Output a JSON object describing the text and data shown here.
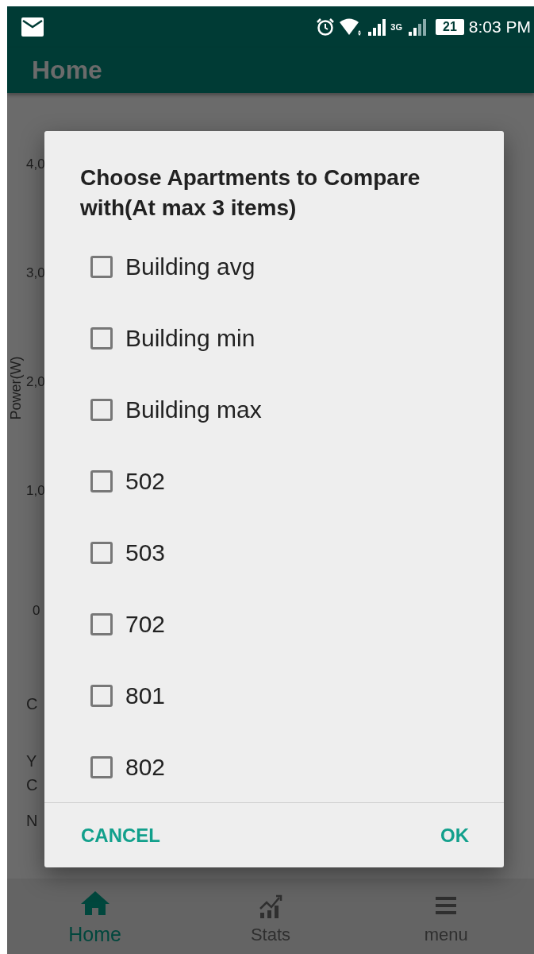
{
  "status_bar": {
    "time": "8:03 PM",
    "network": "3G",
    "battery": "21"
  },
  "app_bar": {
    "title": "Home"
  },
  "background": {
    "y_ticks": [
      "4,0",
      "3,0",
      "2,0",
      "1,0",
      "0"
    ],
    "y_label": "Power(W)",
    "lines": [
      "C",
      "Y",
      "C",
      "N"
    ]
  },
  "dialog": {
    "title": "Choose Apartments to Compare with(At max 3 items)",
    "items": [
      {
        "label": "Building avg",
        "checked": false
      },
      {
        "label": "Building min",
        "checked": false
      },
      {
        "label": "Building max",
        "checked": false
      },
      {
        "label": "502",
        "checked": false
      },
      {
        "label": "503",
        "checked": false
      },
      {
        "label": "702",
        "checked": false
      },
      {
        "label": "801",
        "checked": false
      },
      {
        "label": "802",
        "checked": false
      }
    ],
    "buttons": [
      {
        "label": "CANCEL",
        "kind": "cancel"
      },
      {
        "label": "OK",
        "kind": "ok"
      }
    ]
  },
  "bottom_nav": [
    {
      "label": "Home",
      "kind": "home",
      "selected": true
    },
    {
      "label": "Stats",
      "kind": "stats",
      "selected": false
    },
    {
      "label": "menu",
      "kind": "menu",
      "selected": false
    }
  ]
}
